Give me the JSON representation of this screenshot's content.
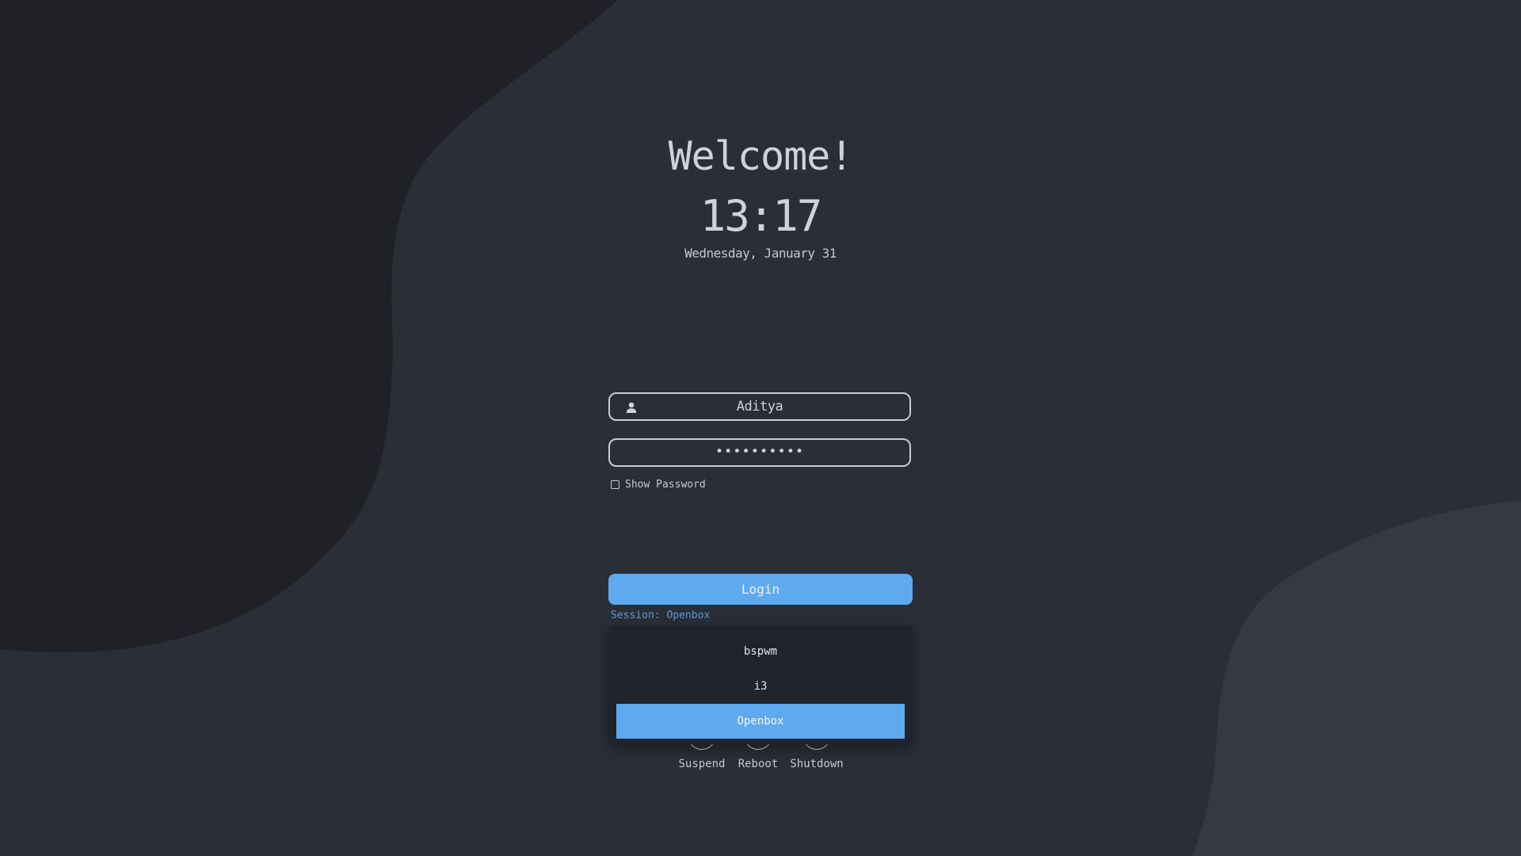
{
  "greeting": "Welcome!",
  "clock": {
    "time": "13:17",
    "date": "Wednesday, January 31"
  },
  "login_form": {
    "username": "Aditya",
    "username_icon": "user-icon",
    "password_masked": "••••••••••",
    "show_password_label": "Show Password",
    "show_password_checked": false,
    "login_label": "Login",
    "session_label": "Session: Openbox"
  },
  "session_menu": {
    "options": [
      "bspwm",
      "i3",
      "Openbox"
    ],
    "selected": "Openbox"
  },
  "power": {
    "suspend": "Suspend",
    "reboot": "Reboot",
    "shutdown": "Shutdown"
  },
  "colors": {
    "background": "#2a2e37",
    "accent": "#5fa9ee",
    "dark_blob": "#1f2126",
    "light_blob": "#353941"
  }
}
